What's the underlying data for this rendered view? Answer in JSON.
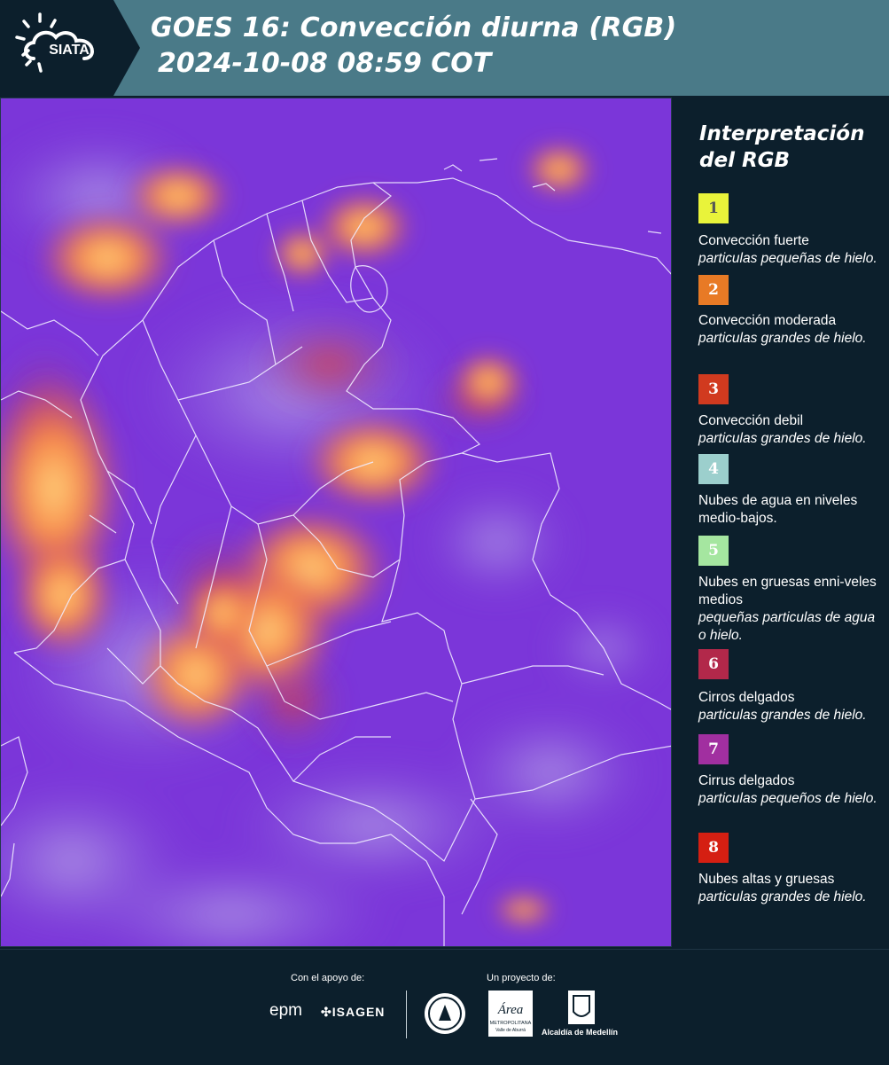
{
  "header": {
    "logo_text": "SIATA",
    "title_line1": "GOES 16: Convección diurna (RGB)",
    "title_line2": "2024-10-08 08:59 COT",
    "background_color": "#4a7a88"
  },
  "legend": {
    "title": "Interpretación del RGB",
    "items": [
      {
        "number": "1",
        "color": "#e9f33a",
        "text_color": "#555",
        "main": "Convección fuerte",
        "sub": "particulas pequeñas de hielo."
      },
      {
        "number": "2",
        "color": "#e87a25",
        "text_color": "#fff",
        "main": "Convección moderada",
        "sub": "particulas grandes de hielo."
      },
      {
        "number": "3",
        "color": "#d13a1f",
        "text_color": "#fff",
        "main": "Convección debil",
        "sub": "particulas grandes de hielo."
      },
      {
        "number": "4",
        "color": "#9ccfcd",
        "text_color": "#fff",
        "main": "Nubes de agua en niveles medio-bajos.",
        "sub": ""
      },
      {
        "number": "5",
        "color": "#a5e6a0",
        "text_color": "#fff",
        "main": "Nubes en gruesas enni-veles medios",
        "sub": "pequeñas particulas de agua o hielo."
      },
      {
        "number": "6",
        "color": "#b2284a",
        "text_color": "#fff",
        "main": "Cirros delgados",
        "sub": "particulas grandes de hielo."
      },
      {
        "number": "7",
        "color": "#a12fa0",
        "text_color": "#fff",
        "main": "Cirrus delgados",
        "sub": "particulas pequeños de hielo."
      },
      {
        "number": "8",
        "color": "#d51f12",
        "text_color": "#fff",
        "main": "Nubes altas y gruesas",
        "sub": "particulas grandes de hielo."
      }
    ]
  },
  "footer": {
    "support_label": "Con el apoyo de:",
    "project_label": "Un proyecto de:",
    "sponsors": [
      "epm",
      "ISAGEN"
    ],
    "partners": [
      "Área METROPOLITANA Valle de Aburrá",
      "Alcaldía de Medellín"
    ]
  },
  "map": {
    "base_color": "#7a37d8"
  }
}
